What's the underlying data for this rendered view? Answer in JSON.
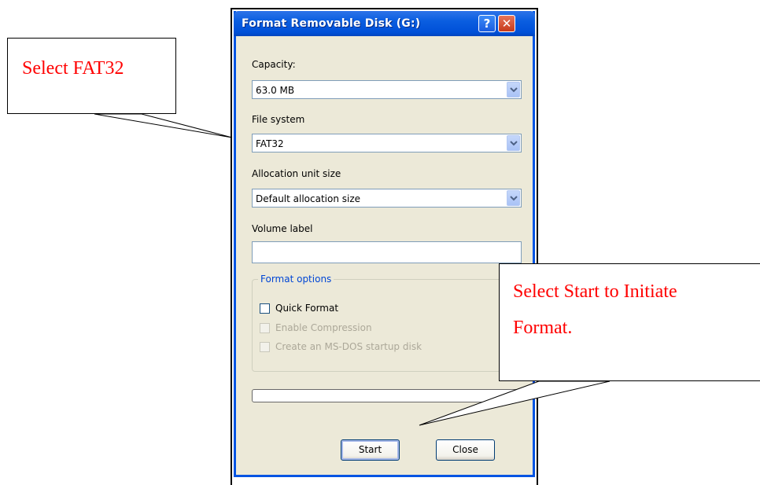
{
  "dialog": {
    "title": "Format Removable Disk (G:)",
    "help_icon": "help-icon",
    "close_icon": "close-icon",
    "capacity": {
      "label": "Capacity:",
      "value": "63.0 MB"
    },
    "file_system": {
      "label": "File system",
      "value": "FAT32"
    },
    "allocation": {
      "label": "Allocation unit size",
      "value": "Default allocation size"
    },
    "volume_label": {
      "label": "Volume label",
      "value": ""
    },
    "format_options": {
      "legend": "Format options",
      "quick_format": {
        "label": "Quick Format",
        "checked": false
      },
      "enable_compression": {
        "label": "Enable Compression",
        "checked": false,
        "disabled": true
      },
      "msdos_startup": {
        "label": "Create an MS-DOS startup disk",
        "checked": false,
        "disabled": true
      }
    },
    "progress": 0,
    "buttons": {
      "start": "Start",
      "close": "Close"
    }
  },
  "callouts": {
    "fat32": "Select FAT32",
    "start_line1": "Select Start to Initiate",
    "start_line2": "Format."
  },
  "colors": {
    "callout_text": "#FF0000",
    "titlebar": "#0054E3",
    "dialog_bg": "#ECE9D8"
  }
}
